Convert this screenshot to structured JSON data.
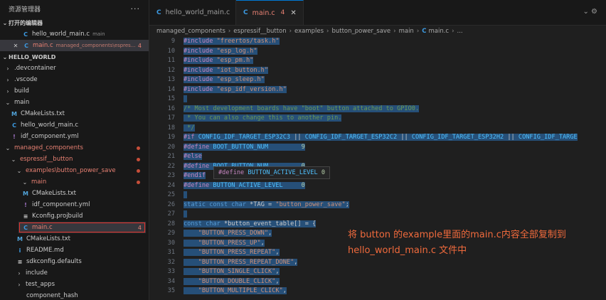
{
  "sidebar": {
    "title": "资源管理器",
    "more": "···",
    "open_editors": {
      "label": "打开的编辑器",
      "items": [
        {
          "name": "hello_world_main.c",
          "desc": "main",
          "icon": "C"
        },
        {
          "name": "main.c",
          "desc": "managed_components\\espres...",
          "icon": "C",
          "count": "4",
          "close": "✕"
        }
      ]
    },
    "project": {
      "label": "HELLO_WORLD",
      "items": [
        {
          "name": ".devcontainer"
        },
        {
          "name": ".vscode"
        },
        {
          "name": "build"
        },
        {
          "name": "main"
        },
        {
          "name": "CMakeLists.txt",
          "icon": "M"
        },
        {
          "name": "hello_world_main.c",
          "icon": "C"
        },
        {
          "name": "idf_component.yml",
          "icon": "!"
        },
        {
          "name": "managed_components"
        },
        {
          "name": "espressif__button"
        },
        {
          "name": "examples\\button_power_save"
        },
        {
          "name": "main"
        },
        {
          "name": "CMakeLists.txt",
          "icon": "M"
        },
        {
          "name": "idf_component.yml",
          "icon": "!"
        },
        {
          "name": "Kconfig.projbuild",
          "icon": "≡"
        },
        {
          "name": "main.c",
          "icon": "C",
          "count": "4"
        },
        {
          "name": "CMakeLists.txt",
          "icon": "M"
        },
        {
          "name": "README.md",
          "icon": "i"
        },
        {
          "name": "sdkconfig.defaults",
          "icon": "≡"
        },
        {
          "name": "include"
        },
        {
          "name": "test_apps"
        },
        {
          "name": "component_hash"
        }
      ]
    }
  },
  "tabs": [
    {
      "label": "hello_world_main.c",
      "icon": "C"
    },
    {
      "label": "main.c",
      "icon": "C",
      "count": "4",
      "close": "✕"
    }
  ],
  "window_controls": "⌄ ⚙",
  "breadcrumbs": [
    "managed_components",
    "espressif__button",
    "examples",
    "button_power_save",
    "main",
    "main.c",
    "..."
  ],
  "editor": {
    "lines": [
      {
        "n": "9",
        "parts": [
          [
            "kw",
            "#include"
          ],
          [
            "",
            " "
          ],
          [
            "st",
            "\"freertos/task.h\""
          ]
        ],
        "sel": true
      },
      {
        "n": "10",
        "parts": [
          [
            "kw",
            "#include"
          ],
          [
            "",
            " "
          ],
          [
            "st",
            "\"esp_log.h\""
          ]
        ],
        "sel": true
      },
      {
        "n": "11",
        "parts": [
          [
            "kw",
            "#include"
          ],
          [
            "",
            " "
          ],
          [
            "st",
            "\"esp_pm.h\""
          ]
        ],
        "sel": true
      },
      {
        "n": "12",
        "parts": [
          [
            "kw",
            "#include"
          ],
          [
            "",
            " "
          ],
          [
            "st",
            "\"iot_button.h\""
          ]
        ],
        "sel": true
      },
      {
        "n": "13",
        "parts": [
          [
            "kw",
            "#include"
          ],
          [
            "",
            " "
          ],
          [
            "st",
            "\"esp_sleep.h\""
          ]
        ],
        "sel": true
      },
      {
        "n": "14",
        "parts": [
          [
            "kw",
            "#include"
          ],
          [
            "",
            " "
          ],
          [
            "st",
            "\"esp_idf_version.h\""
          ]
        ],
        "sel": true
      },
      {
        "n": "15",
        "parts": [
          [
            "",
            ""
          ]
        ],
        "sel": true
      },
      {
        "n": "16",
        "parts": [
          [
            "cm",
            "/* Most development boards have \"boot\" button attached to GPIO0."
          ]
        ],
        "sel": true
      },
      {
        "n": "17",
        "parts": [
          [
            "cm",
            " * You can also change this to another pin."
          ]
        ],
        "sel": true
      },
      {
        "n": "18",
        "parts": [
          [
            "cm",
            " */"
          ]
        ],
        "sel": true
      },
      {
        "n": "19",
        "parts": [
          [
            "kw",
            "#if"
          ],
          [
            "",
            " "
          ],
          [
            "mac",
            "CONFIG_IDF_TARGET_ESP32C3"
          ],
          [
            "",
            " || "
          ],
          [
            "mac",
            "CONFIG_IDF_TARGET_ESP32C2"
          ],
          [
            "",
            " || "
          ],
          [
            "mac",
            "CONFIG_IDF_TARGET_ESP32H2"
          ],
          [
            "",
            " || "
          ],
          [
            "mac",
            "CONFIG_IDF_TARGE"
          ]
        ],
        "sel": true
      },
      {
        "n": "20",
        "parts": [
          [
            "kw",
            "#define"
          ],
          [
            "",
            " "
          ],
          [
            "mac",
            "BOOT_BUTTON_NUM"
          ],
          [
            "",
            "         "
          ],
          [
            "num",
            "9"
          ]
        ],
        "sel": true
      },
      {
        "n": "21",
        "parts": [
          [
            "kw",
            "#else"
          ]
        ],
        "sel": true
      },
      {
        "n": "22",
        "parts": [
          [
            "kw",
            "#define"
          ],
          [
            "",
            " "
          ],
          [
            "mac",
            "BOOT_BUTTON_NUM"
          ],
          [
            "",
            "         "
          ],
          [
            "num",
            "0"
          ]
        ],
        "sel": true
      },
      {
        "n": "23",
        "parts": [
          [
            "kw",
            "#endif"
          ]
        ],
        "sel": true
      },
      {
        "n": "24",
        "parts": [
          [
            "kw",
            "#define"
          ],
          [
            "",
            " "
          ],
          [
            "mac",
            "BUTTON_ACTIVE_LEVEL"
          ],
          [
            "",
            "     "
          ],
          [
            "num",
            "0"
          ]
        ],
        "sel": true
      },
      {
        "n": "25",
        "parts": [
          [
            "",
            ""
          ]
        ],
        "sel": true
      },
      {
        "n": "26",
        "parts": [
          [
            "kb",
            "static"
          ],
          [
            "",
            " "
          ],
          [
            "kb",
            "const"
          ],
          [
            "",
            " "
          ],
          [
            "kb",
            "char"
          ],
          [
            "",
            " *TAG = "
          ],
          [
            "st",
            "\"button_power_save\""
          ],
          [
            "",
            ";"
          ]
        ],
        "sel": true
      },
      {
        "n": "27",
        "parts": [
          [
            "",
            ""
          ]
        ],
        "sel": true
      },
      {
        "n": "28",
        "parts": [
          [
            "kb",
            "const"
          ],
          [
            "",
            " "
          ],
          [
            "kb",
            "char"
          ],
          [
            "",
            " *button_event_table[] = {"
          ]
        ],
        "sel": true
      },
      {
        "n": "29",
        "parts": [
          [
            "",
            "    "
          ],
          [
            "st",
            "\"BUTTON_PRESS_DOWN\""
          ],
          [
            "",
            ","
          ]
        ],
        "sel": true
      },
      {
        "n": "30",
        "parts": [
          [
            "",
            "    "
          ],
          [
            "st",
            "\"BUTTON_PRESS_UP\""
          ],
          [
            "",
            ","
          ]
        ],
        "sel": true
      },
      {
        "n": "31",
        "parts": [
          [
            "",
            "    "
          ],
          [
            "st",
            "\"BUTTON_PRESS_REPEAT\""
          ],
          [
            "",
            ","
          ]
        ],
        "sel": true
      },
      {
        "n": "32",
        "parts": [
          [
            "",
            "    "
          ],
          [
            "st",
            "\"BUTTON_PRESS_REPEAT_DONE\""
          ],
          [
            "",
            ","
          ]
        ],
        "sel": true
      },
      {
        "n": "33",
        "parts": [
          [
            "",
            "    "
          ],
          [
            "st",
            "\"BUTTON_SINGLE_CLICK\""
          ],
          [
            "",
            ","
          ]
        ],
        "sel": true
      },
      {
        "n": "34",
        "parts": [
          [
            "",
            "    "
          ],
          [
            "st",
            "\"BUTTON_DOUBLE_CLICK\""
          ],
          [
            "",
            ","
          ]
        ],
        "sel": true
      },
      {
        "n": "35",
        "parts": [
          [
            "",
            "    "
          ],
          [
            "st",
            "\"BUTTON_MULTIPLE_CLICK\""
          ],
          [
            "",
            ","
          ]
        ],
        "sel": true
      }
    ],
    "hover_tip": {
      "kw": "#define",
      "text": " BUTTON_ACTIVE_LEVEL ",
      "val": "0"
    }
  },
  "annotation": {
    "line1": "将 button 的example里面的main.c内容全部复制到",
    "line2": "hello_world_main.c 文件中"
  },
  "colors": {
    "accent": "#0078d4",
    "highlight_box": "#e3312a",
    "annotation": "#f06a3c",
    "selection": "#264f78"
  }
}
